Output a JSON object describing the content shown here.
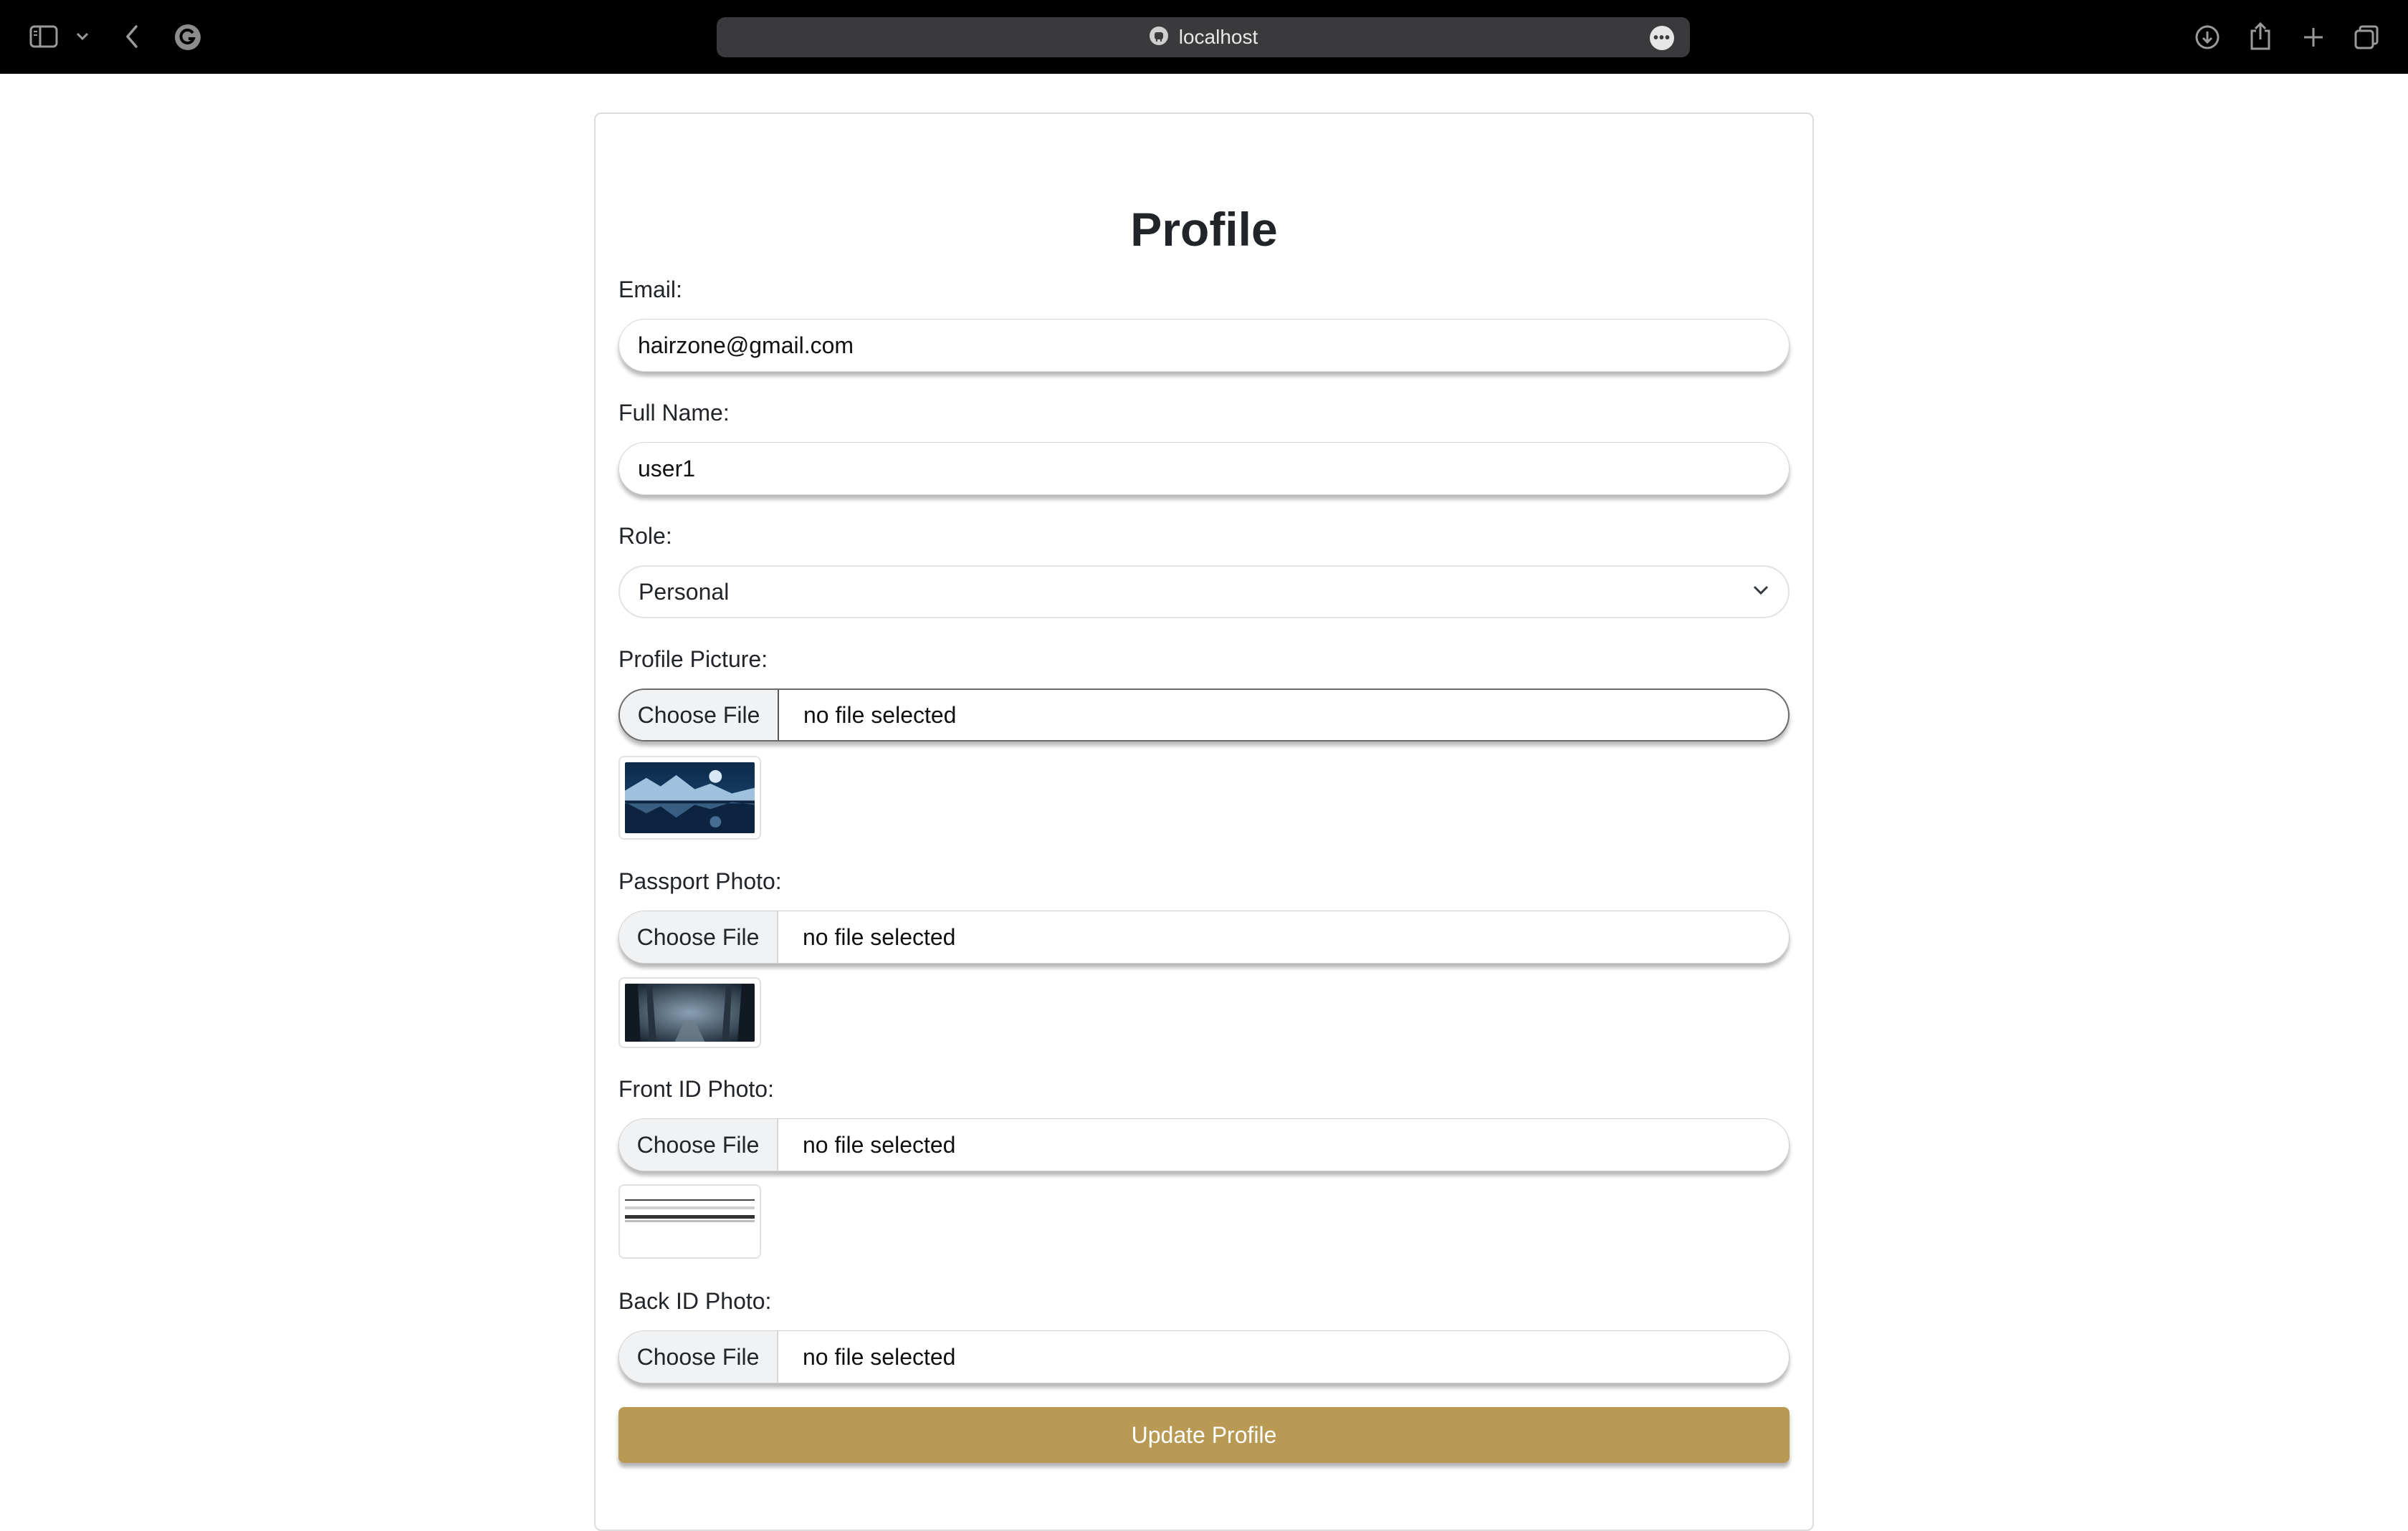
{
  "browser": {
    "address": "localhost",
    "icons": [
      "sidebar-icon",
      "chevron-down-icon",
      "back-icon",
      "grammarly-icon",
      "site-icon",
      "more-icon",
      "download-icon",
      "share-icon",
      "plus-icon",
      "tabs-icon"
    ]
  },
  "page": {
    "title": "Profile",
    "email_label": "Email:",
    "email_value": "hairzone@gmail.com",
    "fullname_label": "Full Name:",
    "fullname_value": "user1",
    "role_label": "Role:",
    "role_value": "Personal",
    "uploads": [
      {
        "label": "Profile Picture:",
        "button": "Choose File",
        "status": "no file selected"
      },
      {
        "label": "Passport Photo:",
        "button": "Choose File",
        "status": "no file selected"
      },
      {
        "label": "Front ID Photo:",
        "button": "Choose File",
        "status": "no file selected"
      },
      {
        "label": "Back ID Photo:",
        "button": "Choose File",
        "status": "no file selected"
      }
    ],
    "submit_label": "Update Profile"
  },
  "colors": {
    "accent": "#b89a55",
    "topbar": "#000000"
  }
}
